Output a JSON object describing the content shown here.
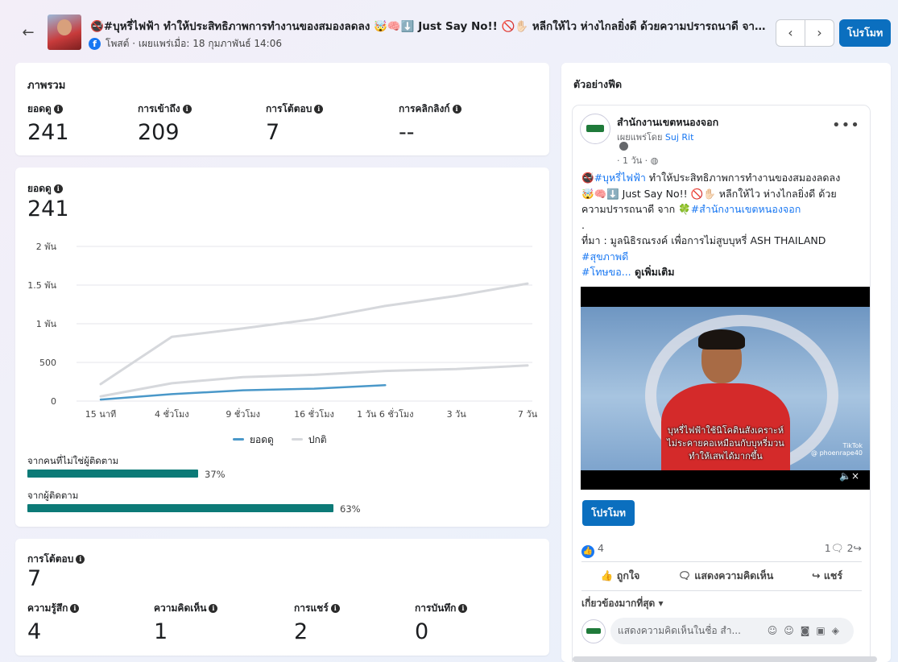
{
  "header": {
    "back_icon": "←",
    "title": "🚭#บุหรี่ไฟฟ้า ทำให้ประสิทธิภาพการทำงานของสมองลดลง 🤯🧠⬇️ Just Say No!! 🚫✋🏻 หลีกให้ไว ห่างไกลยิ่งดี ด้วยความปรารถนาดี จาก 🍀#สำนักงานเขตหนองจอก",
    "meta": "โพสต์ · เผยแพร่เมื่อ: 18 กุมภาพันธ์ 14:06",
    "fb_letter": "f",
    "prev_icon": "‹",
    "next_icon": "›",
    "promote_label": "โปรโมท"
  },
  "overview": {
    "title": "ภาพรวม",
    "metrics": [
      {
        "label": "ยอดดู",
        "value": "241"
      },
      {
        "label": "การเข้าถึง",
        "value": "209"
      },
      {
        "label": "การโต้ตอบ",
        "value": "7"
      },
      {
        "label": "การคลิกลิงก์",
        "value": "--"
      }
    ]
  },
  "views": {
    "label": "ยอดดู",
    "value": "241",
    "legend": [
      {
        "name": "ยอดดู",
        "color": "#4a98c9"
      },
      {
        "name": "ปกติ",
        "color": "#d6d8dc"
      }
    ],
    "bars": [
      {
        "label": "จากคนที่ไม่ใช่ผู้ติดตาม",
        "percent": 37,
        "text": "37%"
      },
      {
        "label": "จากผู้ติดตาม",
        "percent": 63,
        "text": "63%"
      }
    ]
  },
  "chart_data": {
    "type": "line",
    "x": [
      "15 นาที",
      "4 ชั่วโมง",
      "9 ชั่วโมง",
      "16 ชั่วโมง",
      "1 วัน 6 ชั่วโมง",
      "3 วัน",
      "7 วัน"
    ],
    "yticks": [
      "0",
      "500",
      "1 พัน",
      "1.5 พัน",
      "2 พัน"
    ],
    "ylim": [
      0,
      2000
    ],
    "series": [
      {
        "name": "ยอดดู",
        "color": "#4a98c9",
        "values": [
          20,
          90,
          140,
          160,
          205
        ]
      },
      {
        "name": "ปกติ",
        "color": "#d6d8dc",
        "values": [
          220,
          830,
          940,
          1060,
          1230,
          1360,
          1520
        ]
      },
      {
        "name": "ปกติ",
        "color": "#d6d8dc",
        "values": [
          60,
          230,
          310,
          340,
          390,
          415,
          460
        ]
      }
    ]
  },
  "engagement": {
    "label": "การโต้ตอบ",
    "value": "7",
    "metrics": [
      {
        "label": "ความรู้สึก",
        "value": "4"
      },
      {
        "label": "ความคิดเห็น",
        "value": "1"
      },
      {
        "label": "การแชร์",
        "value": "2"
      },
      {
        "label": "การบันทึก",
        "value": "0"
      }
    ]
  },
  "preview": {
    "title": "ตัวอย่างฟีด",
    "page_name": "สำนักงานเขตหนองจอก",
    "published_by_prefix": "เผยแพร่โดย",
    "published_by_name": "Suj Rit",
    "time": "· 1 วัน ·",
    "more_icon": "•••",
    "text": {
      "l1a": "🚭",
      "l1b": "#บุหรี่ไฟฟ้า",
      "l1c": " ทำให้ประสิทธิภาพการทำงานของสมองลดลง",
      "l2": "🤯🧠⬇️ Just Say No!! 🚫✋🏻 หลีกให้ไว ห่างไกลยิ่งดี ด้วย",
      "l3a": "ความปรารถนาดี จาก 🍀",
      "l3b": "#สำนักงานเขตหนองจอก",
      "l4": ".",
      "l5": "ที่มา : มูลนิธิรณรงค์ เพื่อการไม่สูบบุหรี่ ASH THAILAND",
      "l6": "#สุขภาพดี",
      "l7a": "#โทษขอ...",
      "l7b": " ดูเพิ่มเติม"
    },
    "video_subs": [
      "บุหรี่ไฟฟ้าใช้นิโคตินสังเคราะห์",
      "ไม่ระคายคอเหมือนกับบุหรี่มวน",
      "ทำให้เสพได้มากขึ้น"
    ],
    "tiktok": "TikTok",
    "tiktok_handle": "@ phoenrape40",
    "speaker_icon": "🔈×",
    "promote_label": "โปรโมท",
    "likes": "4",
    "comments_count": "1",
    "shares_count": "2",
    "actions": [
      "ถูกใจ",
      "แสดงความคิดเห็น",
      "แชร์"
    ],
    "relevant": "เกี่ยวข้องมากที่สุด ▾",
    "comment_placeholder": "แสดงความคิดเห็นในชื่อ สำ..."
  }
}
